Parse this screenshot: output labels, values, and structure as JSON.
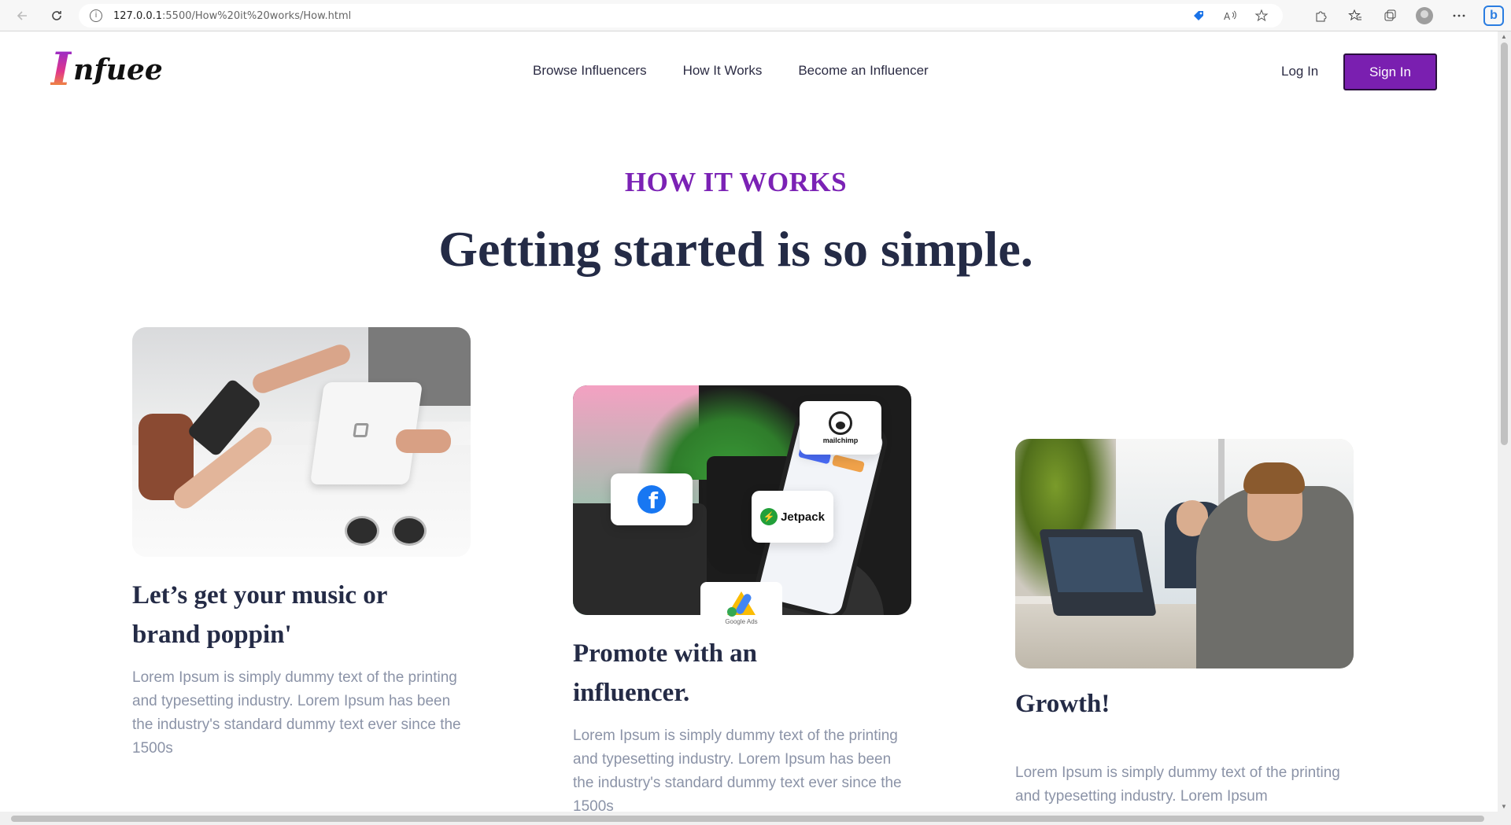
{
  "browser": {
    "url_host": "127.0.0.1",
    "url_path": ":5500/How%20it%20works/How.html"
  },
  "header": {
    "logo_mark": "I",
    "logo_word": "nfuee",
    "nav": [
      {
        "label": "Browse Influencers"
      },
      {
        "label": "How It Works"
      },
      {
        "label": "Become an Influencer"
      }
    ],
    "login_label": "Log In",
    "signin_label": "Sign In"
  },
  "hero": {
    "eyebrow": "HOW IT WORKS",
    "headline": "Getting started is so simple."
  },
  "steps": [
    {
      "title_line1": "Let’s get your music or",
      "title_line2": "brand poppin'",
      "body": "Lorem Ipsum is simply dummy text of the printing and typesetting industry. Lorem Ipsum has been the industry's standard dummy text ever since the 1500s"
    },
    {
      "title_line1": "Promote with an",
      "title_line2": "influencer.",
      "body": "Lorem Ipsum is simply dummy text of the printing and typesetting industry. Lorem Ipsum has been the industry's standard dummy text ever since the 1500s",
      "badges": {
        "mailchimp": "mailchimp",
        "jetpack": "Jetpack",
        "google_ads": "Google Ads",
        "facebook": "f"
      }
    },
    {
      "title_line1": "Growth!",
      "title_line2": "",
      "body": "Lorem Ipsum is simply dummy text of the printing and typesetting industry. Lorem Ipsum"
    }
  ],
  "colors": {
    "accent": "#7a1fb0",
    "heading": "#242b46",
    "body_text": "#8b93a7"
  }
}
